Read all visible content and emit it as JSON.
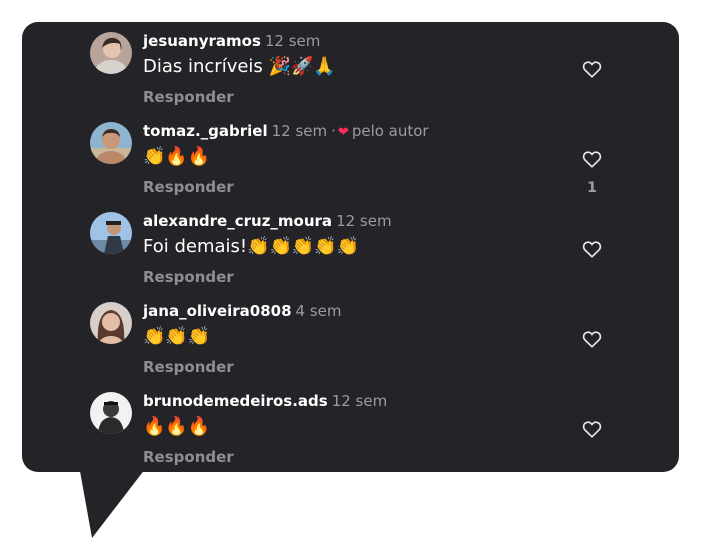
{
  "comments": [
    {
      "user": "jesuanyramos",
      "time": "12 sem",
      "by_author": "",
      "text": "Dias incríveis 🎉🚀🙏",
      "reply": "Responder",
      "likes": ""
    },
    {
      "user": "tomaz._gabriel",
      "time": "12 sem",
      "by_author": "pelo autor",
      "text": "👏🔥🔥",
      "reply": "Responder",
      "likes": "1"
    },
    {
      "user": "alexandre_cruz_moura",
      "time": "12 sem",
      "by_author": "",
      "text": "Foi demais!👏👏👏👏👏",
      "reply": "Responder",
      "likes": ""
    },
    {
      "user": "jana_oliveira0808",
      "time": "4 sem",
      "by_author": "",
      "text": "👏👏👏",
      "reply": "Responder",
      "likes": ""
    },
    {
      "user": "brunodemedeiros.ads",
      "time": "12 sem",
      "by_author": "",
      "text": "🔥🔥🔥",
      "reply": "Responder",
      "likes": ""
    }
  ],
  "colors": {
    "panel": "#242428",
    "author_heart": "#fe2c55",
    "muted": "#9a9aa0"
  }
}
